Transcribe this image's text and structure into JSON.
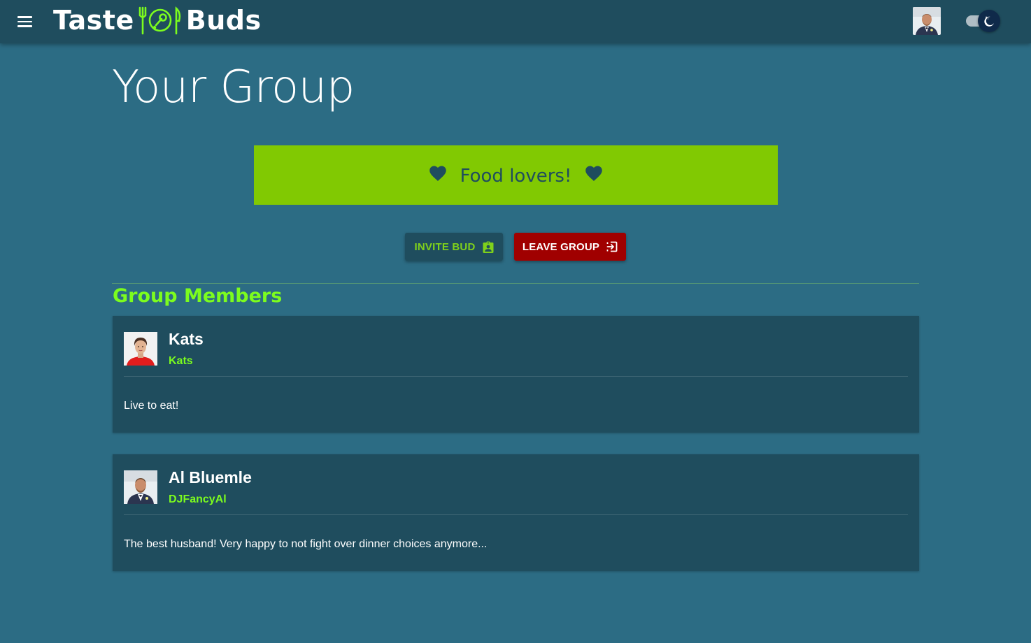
{
  "header": {
    "logo_left": "Taste",
    "logo_right": "Buds",
    "menu_icon": "hamburger-menu-icon",
    "avatar_alt": "Profile avatar",
    "theme_toggle_icon": "moon-icon"
  },
  "page": {
    "title": "Your Group"
  },
  "group": {
    "name": "Food lovers!",
    "banner_color": "#81c902",
    "icon": "heart-icon"
  },
  "actions": {
    "invite_label": "INVITE BUD",
    "invite_icon": "assignment-ind-icon",
    "leave_label": "LEAVE GROUP",
    "leave_icon": "exit-icon"
  },
  "members_section": {
    "title": "Group Members",
    "members": [
      {
        "name": "Kats",
        "username": "Kats",
        "bio": "Live to eat!"
      },
      {
        "name": "Al Bluemle",
        "username": "DJFancyAl",
        "bio": "The best husband! Very happy to not fight over dinner choices anymore..."
      }
    ]
  },
  "colors": {
    "background": "#2c6c84",
    "appbar": "#1f4d5e",
    "accent_green": "#7cfc1e",
    "leave_red": "#a00000"
  }
}
